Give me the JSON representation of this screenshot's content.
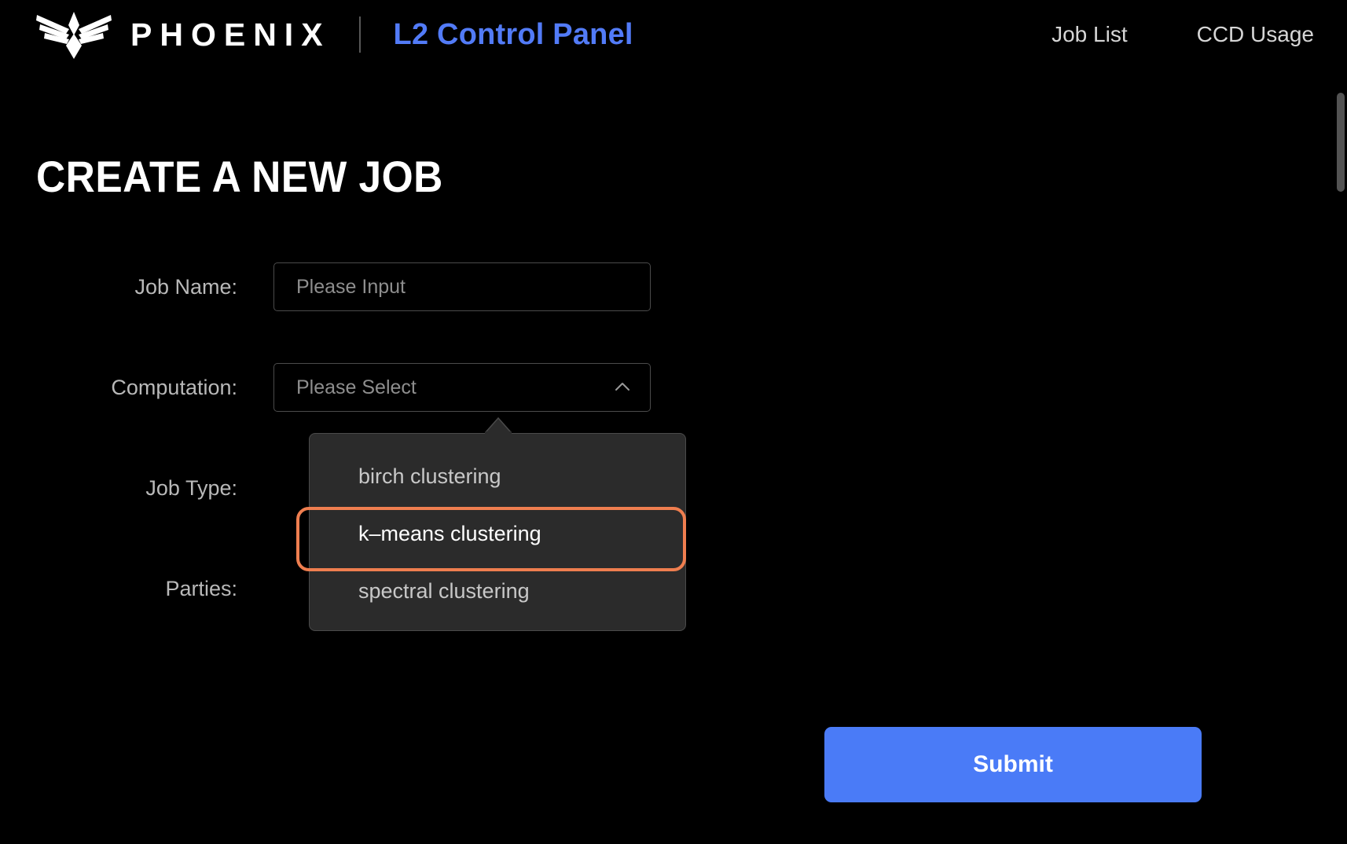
{
  "header": {
    "logo_icon": "phoenix-wings-logo",
    "wordmark": "PHOENIX",
    "panel_title": "L2 Control Panel",
    "panel_title_color": "#527bf7",
    "nav": [
      {
        "label": "Job List"
      },
      {
        "label": "CCD Usage"
      }
    ]
  },
  "page": {
    "title": "CREATE A NEW JOB"
  },
  "form": {
    "fields": [
      {
        "label": "Job Name:",
        "placeholder": "Please Input",
        "value": "",
        "type": "text"
      },
      {
        "label": "Computation:",
        "placeholder": "Please Select",
        "value": "",
        "type": "select"
      },
      {
        "label": "Job Type:",
        "placeholder": "",
        "value": "",
        "type": "hidden"
      },
      {
        "label": "Parties:",
        "placeholder": "",
        "value": "",
        "type": "hidden"
      }
    ],
    "select_chevron_icon": "chevron-up-icon",
    "submit_label": "Submit",
    "submit_color": "#4a7bf7"
  },
  "dropdown": {
    "open": true,
    "highlight_color": "#ef7e4f",
    "background": "#2b2b2b",
    "options": [
      {
        "label": "birch clustering",
        "selected": false
      },
      {
        "label": "k–means clustering",
        "selected": true
      },
      {
        "label": "spectral clustering",
        "selected": false
      }
    ]
  }
}
